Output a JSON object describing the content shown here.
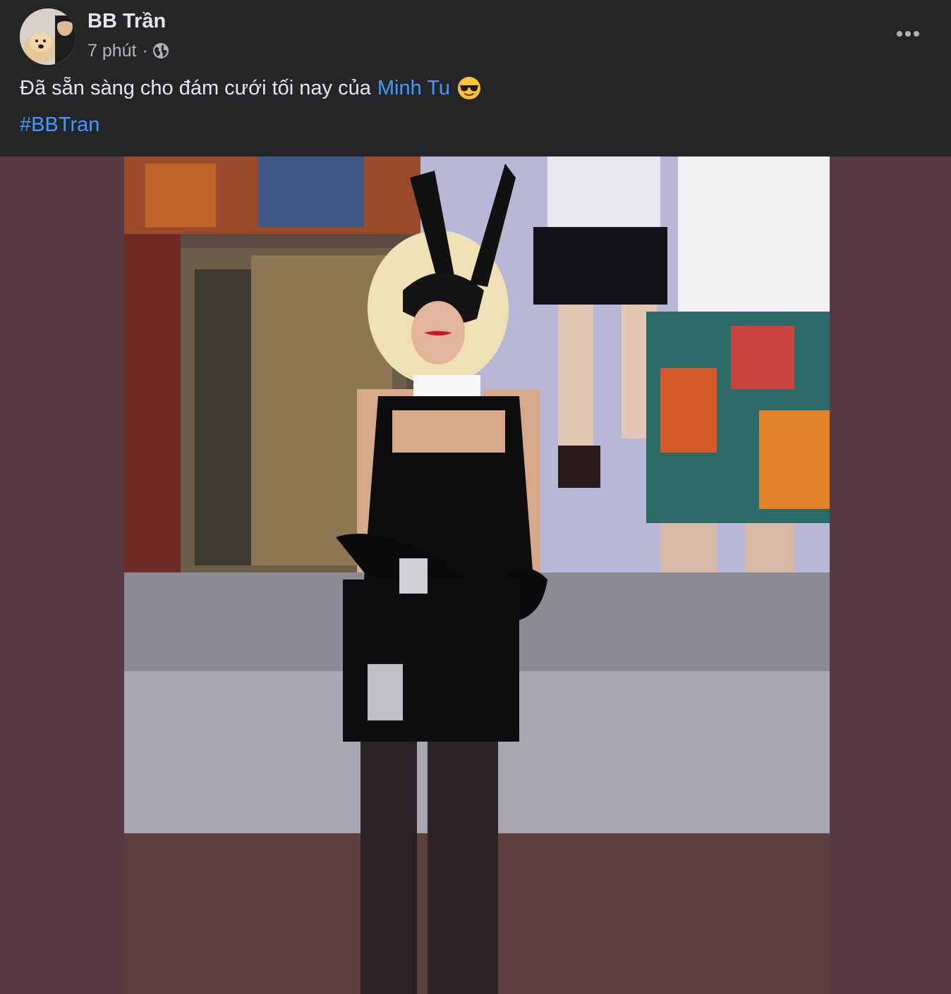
{
  "post": {
    "author": "BB Trần",
    "time": "7 phút",
    "separator": "·",
    "privacy_icon": "globe-icon",
    "more_icon": "more-horizontal-icon",
    "caption_text": "Đã sẵn sàng cho đám cưới tối nay của",
    "mention": "Minh Tu",
    "emoji": "sunglasses-emoji",
    "hashtag": "#BBTran"
  },
  "media": {
    "type": "photo",
    "subject": "performer in black latex outfit with bunny-ear mask on stage"
  },
  "colors": {
    "background": "#242526",
    "text_primary": "#e4e6eb",
    "text_secondary": "#b0b3b8",
    "link": "#4599ff",
    "media_letterbox": "#583943"
  }
}
